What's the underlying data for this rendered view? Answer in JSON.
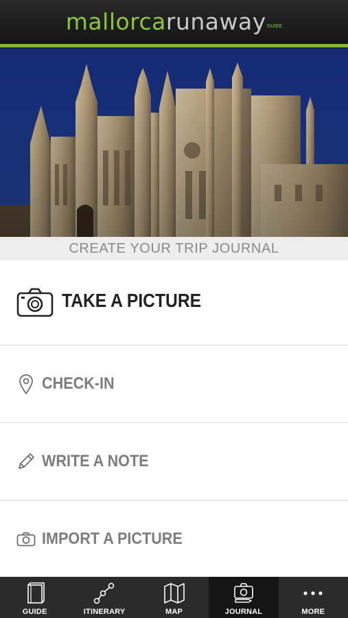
{
  "header": {
    "logo_part1": "mallorca",
    "logo_part2": "runaway",
    "logo_part3": "GUIDE",
    "accent_color": "#86b82e"
  },
  "hero": {
    "image": "illuminated-gothic-cathedral-at-dusk"
  },
  "section": {
    "title": "CREATE YOUR TRIP JOURNAL"
  },
  "actions": {
    "take_picture": {
      "label": "TAKE A PICTURE",
      "icon": "camera-icon"
    },
    "check_in": {
      "label": "CHECK-IN",
      "icon": "location-pin-icon"
    },
    "write_note": {
      "label": "WRITE A NOTE",
      "icon": "pencil-icon"
    },
    "import_picture": {
      "label": "IMPORT A PICTURE",
      "icon": "camera-small-icon"
    }
  },
  "tabs": [
    {
      "label": "GUIDE",
      "icon": "book-icon",
      "active": false
    },
    {
      "label": "ITINERARY",
      "icon": "route-icon",
      "active": false
    },
    {
      "label": "MAP",
      "icon": "map-icon",
      "active": false
    },
    {
      "label": "JOURNAL",
      "icon": "journal-camera-icon",
      "active": true
    },
    {
      "label": "MORE",
      "icon": "more-dots-icon",
      "active": false
    }
  ]
}
